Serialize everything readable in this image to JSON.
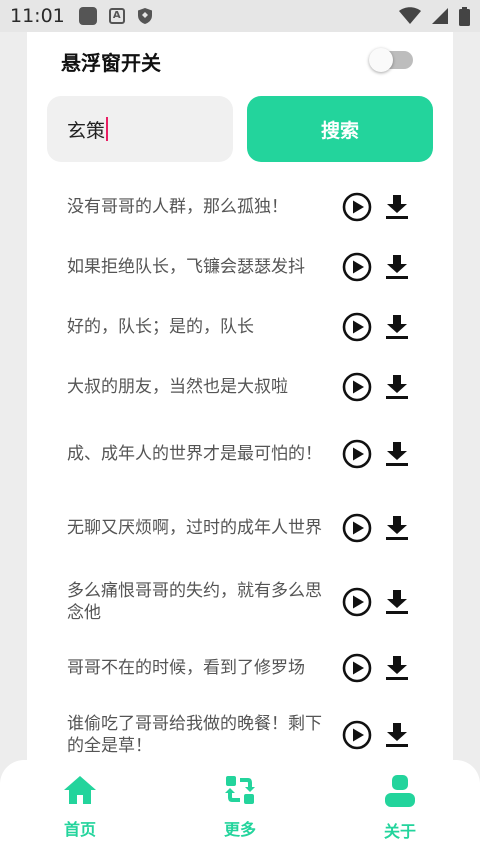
{
  "status_bar": {
    "time": "11:01",
    "left_icons": [
      "app-square-icon",
      "a-box-icon",
      "shield-icon"
    ],
    "right_icons": [
      "wifi-icon",
      "signal-icon",
      "battery-icon"
    ]
  },
  "floating_window": {
    "label": "悬浮窗开关",
    "enabled": false
  },
  "search": {
    "value": "玄策",
    "button_label": "搜索"
  },
  "colors": {
    "accent": "#23d49c",
    "caret": "#e91e63",
    "text": "#555555"
  },
  "items": [
    {
      "text": "没有哥哥的人群，那么孤独！"
    },
    {
      "text": "如果拒绝队长，飞镰会瑟瑟发抖"
    },
    {
      "text": "好的，队长；是的，队长"
    },
    {
      "text": "大叔的朋友，当然也是大叔啦"
    },
    {
      "text": "成、成年人的世界才是最可怕的！"
    },
    {
      "text": "无聊又厌烦啊，过时的成年人世界"
    },
    {
      "text": "多么痛恨哥哥的失约，就有多么思念他"
    },
    {
      "text": "哥哥不在的时候，看到了修罗场"
    },
    {
      "text": "谁偷吃了哥哥给我做的晚餐！剩下的全是草！"
    }
  ],
  "nav": [
    {
      "label": "首页",
      "icon": "home-icon"
    },
    {
      "label": "更多",
      "icon": "refresh-icon"
    },
    {
      "label": "关于",
      "icon": "user-icon"
    }
  ]
}
